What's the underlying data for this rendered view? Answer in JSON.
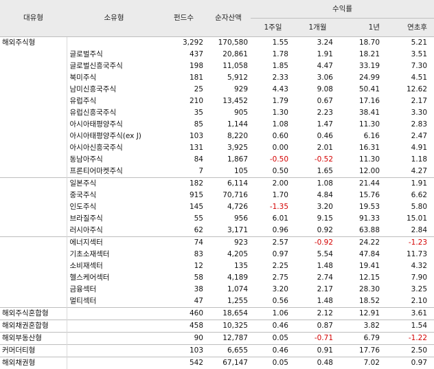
{
  "header": {
    "major_type": "대유형",
    "minor_type": "소유형",
    "fund_count": "펀드수",
    "net_assets": "순자산액",
    "returns_group": "수익률",
    "ret_1w": "1주일",
    "ret_1m": "1개월",
    "ret_1y": "1년",
    "ret_ytd": "연초후"
  },
  "rows": [
    {
      "cat": "해외주식형",
      "sub": "",
      "count": "3,292",
      "assets": "170,580",
      "r1": "1.55",
      "r2": "3.24",
      "r3": "18.70",
      "r4": "5.21",
      "neg": [],
      "group": true
    },
    {
      "cat": "",
      "sub": "글로벌주식",
      "count": "437",
      "assets": "20,861",
      "r1": "1.78",
      "r2": "1.91",
      "r3": "18.21",
      "r4": "3.51",
      "neg": []
    },
    {
      "cat": "",
      "sub": "글로벌신흥국주식",
      "count": "198",
      "assets": "11,058",
      "r1": "1.85",
      "r2": "4.47",
      "r3": "33.19",
      "r4": "7.30",
      "neg": []
    },
    {
      "cat": "",
      "sub": "북미주식",
      "count": "181",
      "assets": "5,912",
      "r1": "2.33",
      "r2": "3.06",
      "r3": "24.99",
      "r4": "4.51",
      "neg": []
    },
    {
      "cat": "",
      "sub": "남미신흥국주식",
      "count": "25",
      "assets": "929",
      "r1": "4.43",
      "r2": "9.08",
      "r3": "50.41",
      "r4": "12.62",
      "neg": []
    },
    {
      "cat": "",
      "sub": "유럽주식",
      "count": "210",
      "assets": "13,452",
      "r1": "1.79",
      "r2": "0.67",
      "r3": "17.16",
      "r4": "2.17",
      "neg": []
    },
    {
      "cat": "",
      "sub": "유럽신흥국주식",
      "count": "35",
      "assets": "905",
      "r1": "1.30",
      "r2": "2.23",
      "r3": "38.41",
      "r4": "3.30",
      "neg": []
    },
    {
      "cat": "",
      "sub": "아시아태평양주식",
      "count": "85",
      "assets": "1,144",
      "r1": "1.08",
      "r2": "1.47",
      "r3": "11.30",
      "r4": "2.83",
      "neg": []
    },
    {
      "cat": "",
      "sub": "아시아태평양주식(ex J)",
      "count": "103",
      "assets": "8,220",
      "r1": "0.60",
      "r2": "0.46",
      "r3": "6.16",
      "r4": "2.47",
      "neg": []
    },
    {
      "cat": "",
      "sub": "아시아신흥국주식",
      "count": "131",
      "assets": "3,925",
      "r1": "0.00",
      "r2": "2.01",
      "r3": "16.31",
      "r4": "4.91",
      "neg": []
    },
    {
      "cat": "",
      "sub": "동남아주식",
      "count": "84",
      "assets": "1,867",
      "r1": "-0.50",
      "r2": "-0.52",
      "r3": "11.30",
      "r4": "1.18",
      "neg": [
        "r1",
        "r2"
      ]
    },
    {
      "cat": "",
      "sub": "프론티어마켓주식",
      "count": "7",
      "assets": "105",
      "r1": "0.50",
      "r2": "1.65",
      "r3": "12.00",
      "r4": "4.27",
      "neg": []
    },
    {
      "cat": "",
      "sub": "일본주식",
      "count": "182",
      "assets": "6,114",
      "r1": "2.00",
      "r2": "1.08",
      "r3": "21.44",
      "r4": "1.91",
      "neg": [],
      "line": true
    },
    {
      "cat": "",
      "sub": "중국주식",
      "count": "915",
      "assets": "70,716",
      "r1": "1.70",
      "r2": "4.84",
      "r3": "15.76",
      "r4": "6.62",
      "neg": []
    },
    {
      "cat": "",
      "sub": "인도주식",
      "count": "145",
      "assets": "4,726",
      "r1": "-1.35",
      "r2": "3.20",
      "r3": "19.53",
      "r4": "5.80",
      "neg": [
        "r1"
      ]
    },
    {
      "cat": "",
      "sub": "브라질주식",
      "count": "55",
      "assets": "956",
      "r1": "6.01",
      "r2": "9.15",
      "r3": "91.33",
      "r4": "15.01",
      "neg": []
    },
    {
      "cat": "",
      "sub": "러시아주식",
      "count": "62",
      "assets": "3,171",
      "r1": "0.96",
      "r2": "0.92",
      "r3": "63.88",
      "r4": "2.84",
      "neg": []
    },
    {
      "cat": "",
      "sub": "에너지섹터",
      "count": "74",
      "assets": "923",
      "r1": "2.57",
      "r2": "-0.92",
      "r3": "24.22",
      "r4": "-1.23",
      "neg": [
        "r2",
        "r4"
      ],
      "line": true
    },
    {
      "cat": "",
      "sub": "기초소재섹터",
      "count": "83",
      "assets": "4,205",
      "r1": "0.97",
      "r2": "5.54",
      "r3": "47.84",
      "r4": "11.73",
      "neg": []
    },
    {
      "cat": "",
      "sub": "소비재섹터",
      "count": "12",
      "assets": "135",
      "r1": "2.25",
      "r2": "1.48",
      "r3": "19.41",
      "r4": "4.32",
      "neg": []
    },
    {
      "cat": "",
      "sub": "헬스케어섹터",
      "count": "58",
      "assets": "4,189",
      "r1": "2.75",
      "r2": "2.74",
      "r3": "12.15",
      "r4": "7.90",
      "neg": []
    },
    {
      "cat": "",
      "sub": "금융섹터",
      "count": "38",
      "assets": "1,074",
      "r1": "3.20",
      "r2": "2.17",
      "r3": "28.30",
      "r4": "3.25",
      "neg": []
    },
    {
      "cat": "",
      "sub": "멀티섹터",
      "count": "47",
      "assets": "1,255",
      "r1": "0.56",
      "r2": "1.48",
      "r3": "18.52",
      "r4": "2.10",
      "neg": []
    },
    {
      "cat": "해외주식혼합형",
      "sub": "",
      "count": "460",
      "assets": "18,654",
      "r1": "1.06",
      "r2": "2.12",
      "r3": "12.91",
      "r4": "3.61",
      "neg": [],
      "group": true
    },
    {
      "cat": "해외채권혼합형",
      "sub": "",
      "count": "458",
      "assets": "10,325",
      "r1": "0.46",
      "r2": "0.87",
      "r3": "3.82",
      "r4": "1.54",
      "neg": [],
      "group": true
    },
    {
      "cat": "해외부동산형",
      "sub": "",
      "count": "90",
      "assets": "12,787",
      "r1": "0.05",
      "r2": "-0.71",
      "r3": "6.79",
      "r4": "-1.22",
      "neg": [
        "r2",
        "r4"
      ],
      "group": true
    },
    {
      "cat": "커머더티형",
      "sub": "",
      "count": "103",
      "assets": "6,655",
      "r1": "0.46",
      "r2": "0.91",
      "r3": "17.76",
      "r4": "2.50",
      "neg": [],
      "group": true
    },
    {
      "cat": "해외채권형",
      "sub": "",
      "count": "542",
      "assets": "67,147",
      "r1": "0.05",
      "r2": "0.48",
      "r3": "7.02",
      "r4": "0.97",
      "neg": [],
      "group": true
    }
  ],
  "colors": {
    "negative": "#d40000",
    "header_bg": "#ebebeb"
  }
}
